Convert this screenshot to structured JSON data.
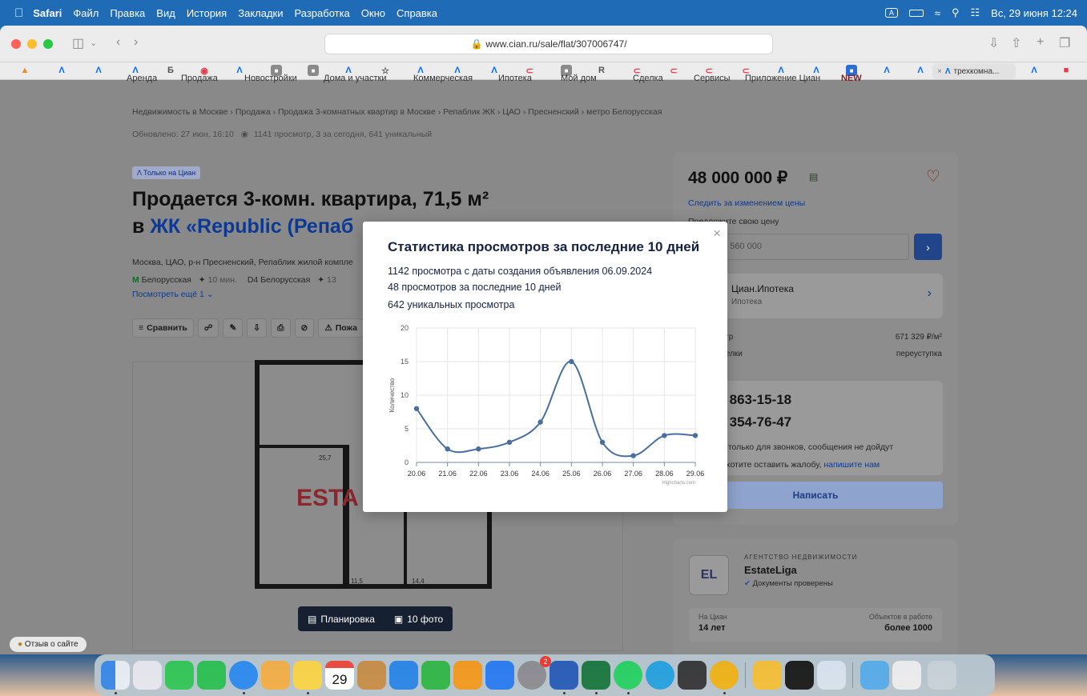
{
  "menubar": {
    "app": "Safari",
    "items": [
      "Файл",
      "Правка",
      "Вид",
      "История",
      "Закладки",
      "Разработка",
      "Окно",
      "Справка"
    ],
    "keyboard": "A",
    "clock": "Вс, 29 июня 12:24"
  },
  "browser": {
    "url": "www.cian.ru/sale/flat/307006747/",
    "active_tab": "трехкомна..."
  },
  "site_nav": [
    "Аренда",
    "Продажа",
    "Новостройки",
    "Дома и участки",
    "Коммерческая",
    "Ипотека",
    "Мой дом",
    "Сделка",
    "Сервисы",
    "Приложение Циан",
    "NEW"
  ],
  "listing": {
    "breadcrumbs": "Недвижимость в Москве  ›  Продажа  ›  Продажа 3-комнатных квартир в Москве  ›  Репаблик ЖК  ›  ЦАО  ›  Пресненский  ›  метро Белорусская",
    "updated": "Обновлено: 27 июн, 16:10",
    "views": "1141 просмотр, 3 за сегодня, 641 уникальный",
    "badge": "Только на Циан",
    "title_line1": "Продается 3-комн. квартира, 71,5 м²",
    "title_prefix": "в ",
    "title_link": "ЖК «Republic (Репаб",
    "address": "Москва, ЦАО, р-н Пресненский, Репаблик жилой компле",
    "metro1": "Белорусская",
    "metro1_time": "10 мин.",
    "metro2": "D4 Белорусская",
    "metro2_time": "13",
    "more": "Посмотреть ещё 1",
    "compare": "Сравнить",
    "complain": "Пожа",
    "plan_text": "ESTA",
    "room1": "25,7",
    "room2": "11,5",
    "room3": "14,4",
    "plan_button": "Планировка",
    "photos_button": "10 фото",
    "feedback": "Отзыв о сайте"
  },
  "sidebar": {
    "price": "48 000 000 ₽",
    "follow": "Следить за изменением цены",
    "offer": "Предложите свою цену",
    "input_placeholder": "мер, 46 560 000",
    "mortgage_title": "Циан.Ипотека",
    "mortgage_sub": "Ипотека",
    "k1": "етр",
    "v1": "671 329 ₽/м²",
    "k2": "делки",
    "v2": "переуступка",
    "phone1": "16 863-15-18",
    "phone2": "15 354-76-47",
    "note1": "мер только для звонков, сообщения не дойдут",
    "note2": "и захотите оставить жалобу,",
    "note2_link": "напишите нам",
    "write": "Написать",
    "agency_label": "АГЕНТСТВО НЕДВИЖИМОСТИ",
    "agency_name": "EstateLiga",
    "agency_logo": "EL",
    "verified": "Документы проверены",
    "on_cian_label": "На Циан",
    "on_cian_value": "14 лет",
    "objects_label": "Объектов в работе",
    "objects_value": "более 1000"
  },
  "modal": {
    "title": "Статистика просмотров за последние 10 дней",
    "line1": "1142 просмотра с даты создания объявления 06.09.2024",
    "line2": "48 просмотров за последние 10 дней",
    "line3": "642 уникальных просмотра",
    "credit": "Highcharts.com"
  },
  "chart_data": {
    "type": "line",
    "x": [
      "20.06",
      "21.06",
      "22.06",
      "23.06",
      "24.06",
      "25.06",
      "26.06",
      "27.06",
      "28.06",
      "29.06"
    ],
    "series": [
      {
        "values": [
          8,
          2,
          2,
          3,
          6,
          15,
          3,
          1,
          4,
          4
        ]
      }
    ],
    "ylabel": "Количество",
    "ylim": [
      0,
      20
    ],
    "yticks": [
      0,
      5,
      10,
      15,
      20
    ],
    "grid": true,
    "line_color": "#4a6f9e"
  },
  "dock": {
    "calendar_month": "ИЮНЬ",
    "calendar_day": "29",
    "badge": "2"
  }
}
